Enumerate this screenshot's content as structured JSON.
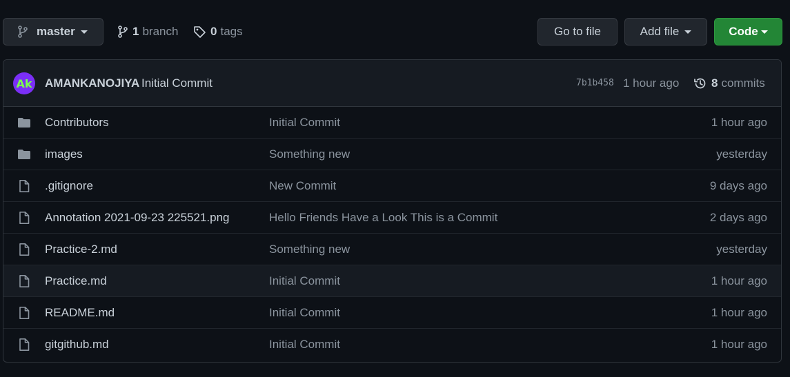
{
  "toolbar": {
    "branch_name": "master",
    "branch_count": "1",
    "branch_word": "branch",
    "tag_count": "0",
    "tag_word": "tags",
    "go_to_file": "Go to file",
    "add_file": "Add file",
    "code": "Code"
  },
  "latest_commit": {
    "avatar_initials": "Ak",
    "author": "AMANKANOJIYA",
    "message": "Initial Commit",
    "sha": "7b1b458",
    "time": "1 hour ago",
    "commit_count": "8",
    "commit_word": "commits"
  },
  "files": [
    {
      "type": "folder",
      "name": "Contributors",
      "message": "Initial Commit",
      "age": "1 hour ago"
    },
    {
      "type": "folder",
      "name": "images",
      "message": "Something new",
      "age": "yesterday"
    },
    {
      "type": "file",
      "name": ".gitignore",
      "message": "New Commit",
      "age": "9 days ago"
    },
    {
      "type": "file",
      "name": "Annotation 2021-09-23 225521.png",
      "message": "Hello Friends Have a Look This is a Commit",
      "age": "2 days ago"
    },
    {
      "type": "file",
      "name": "Practice-2.md",
      "message": "Something new",
      "age": "yesterday"
    },
    {
      "type": "file",
      "name": "Practice.md",
      "message": "Initial Commit",
      "age": "1 hour ago"
    },
    {
      "type": "file",
      "name": "README.md",
      "message": "Initial Commit",
      "age": "1 hour ago"
    },
    {
      "type": "file",
      "name": "gitgithub.md",
      "message": "Initial Commit",
      "age": "1 hour ago"
    }
  ],
  "colors": {
    "background": "#0d1117",
    "code_button": "#238636",
    "avatar_bg": "#7b2ff7",
    "avatar_text": "#7cff4d"
  }
}
